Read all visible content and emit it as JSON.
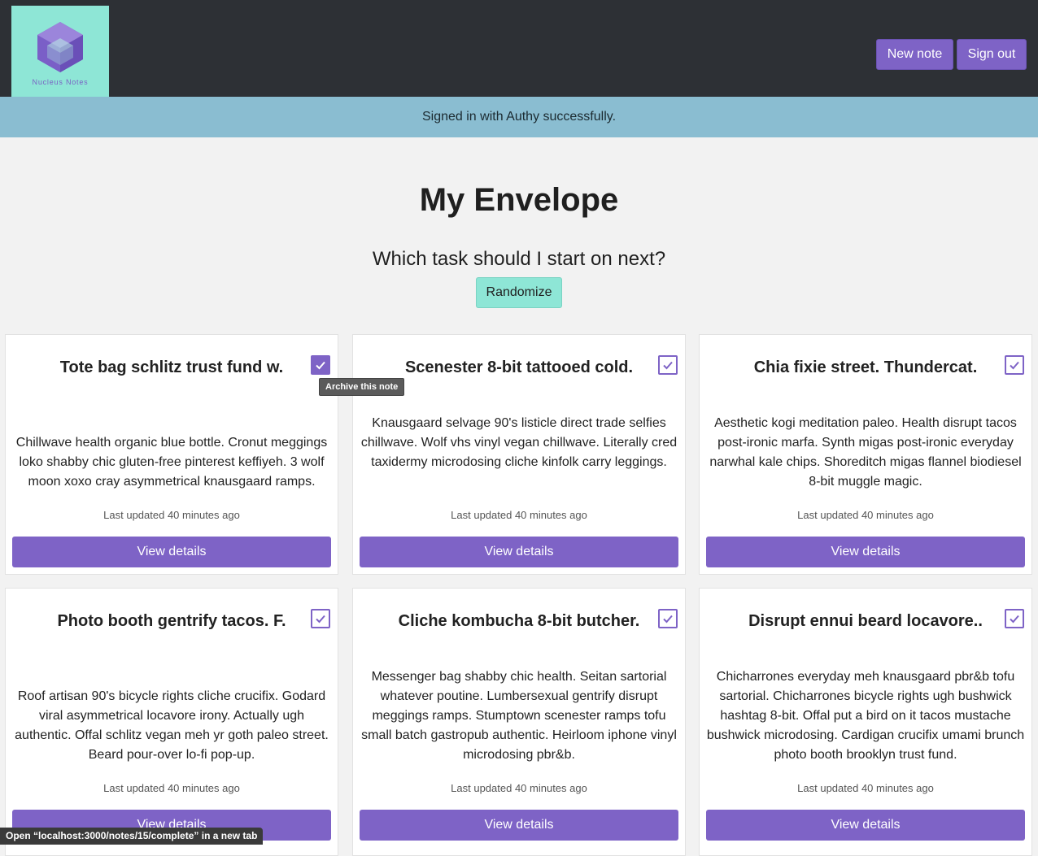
{
  "header": {
    "logo_text": "Nucleus Notes",
    "new_note_label": "New note",
    "sign_out_label": "Sign out"
  },
  "flash": {
    "message": "Signed in with Authy successfully."
  },
  "main": {
    "title": "My Envelope",
    "subtitle": "Which task should I start on next?",
    "randomize_label": "Randomize"
  },
  "notes": [
    {
      "title": "Tote bag schlitz trust fund w.",
      "body": "Chillwave health organic blue bottle. Cronut meggings loko shabby chic gluten-free pinterest keffiyeh. 3 wolf moon xoxo cray asymmetrical knausgaard ramps.",
      "updated": "Last updated 40 minutes ago",
      "button": "View details",
      "archived_checked": true
    },
    {
      "title": "Scenester 8-bit tattooed cold.",
      "body": "Knausgaard selvage 90's listicle direct trade selfies chillwave. Wolf vhs vinyl vegan chillwave. Literally cred taxidermy microdosing cliche kinfolk carry leggings.",
      "updated": "Last updated 40 minutes ago",
      "button": "View details",
      "archived_checked": false
    },
    {
      "title": "Chia fixie street. Thundercat.",
      "body": "Aesthetic kogi meditation paleo. Health disrupt tacos post-ironic marfa. Synth migas post-ironic everyday narwhal kale chips. Shoreditch migas flannel biodiesel 8-bit muggle magic.",
      "updated": "Last updated 40 minutes ago",
      "button": "View details",
      "archived_checked": false
    },
    {
      "title": "Photo booth gentrify tacos. F.",
      "body": "Roof artisan 90's bicycle rights cliche crucifix. Godard viral asymmetrical locavore irony. Actually ugh authentic. Offal schlitz vegan meh yr goth paleo street. Beard pour-over lo-fi pop-up.",
      "updated": "Last updated 40 minutes ago",
      "button": "View details",
      "archived_checked": false
    },
    {
      "title": "Cliche kombucha 8-bit butcher.",
      "body": "Messenger bag shabby chic health. Seitan sartorial whatever poutine. Lumbersexual gentrify disrupt meggings ramps. Stumptown scenester ramps tofu small batch gastropub authentic. Heirloom iphone vinyl microdosing pbr&b.",
      "updated": "Last updated 40 minutes ago",
      "button": "View details",
      "archived_checked": false
    },
    {
      "title": "Disrupt ennui beard locavore..",
      "body": "Chicharrones everyday meh knausgaard pbr&b tofu sartorial. Chicharrones bicycle rights ugh bushwick hashtag 8-bit. Offal put a bird on it tacos mustache bushwick microdosing. Cardigan crucifix umami brunch photo booth brooklyn trust fund.",
      "updated": "Last updated 40 minutes ago",
      "button": "View details",
      "archived_checked": false
    }
  ],
  "tooltip": {
    "text": "Archive this note"
  },
  "statusbar": {
    "text": "Open “localhost:3000/notes/15/complete” in a new tab"
  },
  "colors": {
    "navbar": "#2d3035",
    "accent": "#7e63c6",
    "logo_bg": "#8ee6d6",
    "flash_bg": "#8abdd1",
    "page_bg": "#f2f2f2"
  }
}
